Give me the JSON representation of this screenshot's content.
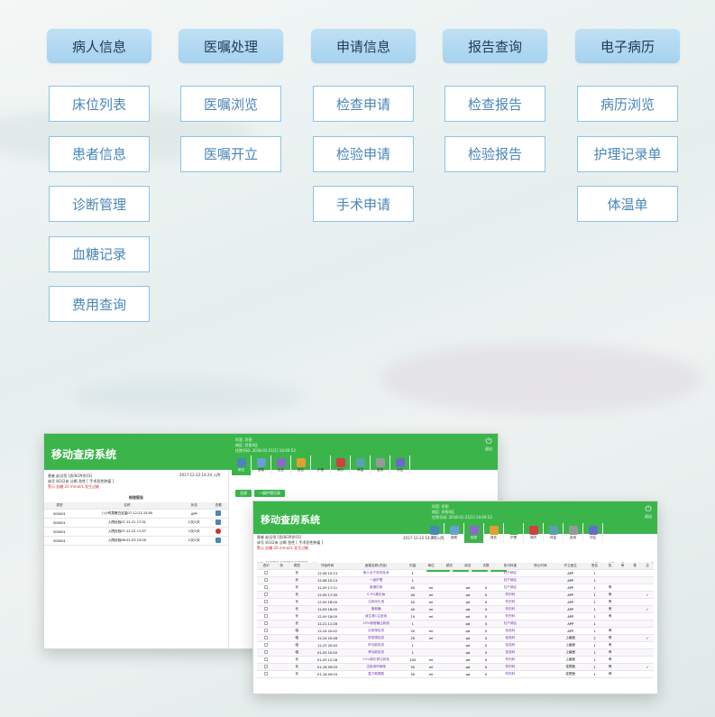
{
  "menu": {
    "columns": [
      {
        "header": "病人信息",
        "items": [
          "床位列表",
          "患者信息",
          "诊断管理",
          "血糖记录",
          "费用查询"
        ]
      },
      {
        "header": "医嘱处理",
        "items": [
          "医嘱浏览",
          "医嘱开立"
        ]
      },
      {
        "header": "申请信息",
        "items": [
          "检查申请",
          "检验申请",
          "手术申请"
        ]
      },
      {
        "header": "报告查询",
        "items": [
          "检查报告",
          "检验报告"
        ]
      },
      {
        "header": "电子病历",
        "items": [
          "病历浏览",
          "护理记录单",
          "体温单"
        ]
      }
    ]
  },
  "screen1": {
    "app_title": "移动查房系统",
    "exit_label": "退出",
    "patient_line1": "患者  赵远恒 [男/8/29岁03]",
    "patient_line2": "床号  8/3/2床     诊断  急性 [ 手术恶性肿瘤 ]",
    "patient_line3": "警示  血糖 20 mmol/L 发生过敏",
    "date_text": "2017-12-22 14:24 入院",
    "header_info": "科室: 肝胆\n病区: 肝胆4区\n住院号码: 2018-01-21[1] 14:00:53",
    "toolbar": [
      "床位",
      "医嘱",
      "检查",
      "报告",
      "护理",
      "病历",
      "体温",
      "费用",
      "评估"
    ],
    "sub_buttons": [
      "全部",
      "一级护理记录"
    ],
    "table_title": "检验报告",
    "columns": [
      "类型",
      "名称",
      "状态",
      "查看"
    ],
    "rows": [
      [
        "000001",
        "八小时尿蛋白定量07-12-22 15:00",
        "APP",
        ""
      ],
      [
        "000001",
        "入院化验07-12-21 17:31",
        "1次/1天",
        ""
      ],
      [
        "000001",
        "入院化验07-12-22 11:57",
        "1次/1天",
        ""
      ],
      [
        "000001",
        "入院化验08-01-03 15:00",
        "1次/1天",
        ""
      ]
    ]
  },
  "screen2": {
    "app_title": "移动查房系统",
    "exit_label": "退出",
    "patient_line1": "患者  赵远恒 [男/8/29岁03]",
    "patient_line2": "床号  8/3/2床     诊断  急性 [ 手术恶性肿瘤 ]",
    "patient_line3": "警示  血糖 20 mmol/L 发生过敏",
    "date_text": "2017-12-22 14:24 入院",
    "header_info": "科室: 肝胆\n病区: 肝胆4区\n住院号码: 2018-01-21[1] 14:00:53",
    "toolbar": [
      "床位",
      "医嘱",
      "检查",
      "报告",
      "护理",
      "病历",
      "体温",
      "费用",
      "评估"
    ],
    "filter_label": "类型",
    "filter_values": [
      "全部",
      "长期",
      "全部"
    ],
    "search_label": "查询",
    "action_buttons": [
      "新开医嘱",
      "停止",
      "作废",
      "打印"
    ],
    "legend": "■ 已过 ■ 新开 ■ 停止 ■ 作废 ■ 执行",
    "columns": [
      "选中",
      "状",
      "类型",
      "开始时间",
      "医嘱名称(内容)",
      "剂量",
      "单位",
      "频次",
      "用法",
      "天数",
      "执行科室",
      "停止时间",
      "开立医生",
      "签名",
      "执",
      "审",
      "核",
      "注"
    ],
    "rows": [
      [
        "",
        "",
        "长",
        "12-08 10:13",
        "病人全子宫切除术",
        "1",
        "",
        "",
        "",
        "",
        "妇产病区",
        "",
        "APP",
        "1",
        "",
        "",
        "",
        ""
      ],
      [
        "",
        "",
        "长",
        "12-08 10:13",
        "一级护理",
        "1",
        "",
        "",
        "",
        "",
        "妇产病区",
        "",
        "APP",
        "1",
        "",
        "",
        "",
        ""
      ],
      [
        "",
        "",
        "长",
        "12-09 17:11",
        "普通饮食",
        "40",
        "ml",
        "",
        "qd",
        "0",
        "妇产病区",
        "",
        "APP",
        "1",
        "有",
        "",
        "",
        ""
      ],
      [
        "",
        "",
        "长",
        "12-09 17:35",
        "0.9%氯化钠",
        "40",
        "ml",
        "",
        "qd",
        "0",
        "药剂科",
        "",
        "APP",
        "1",
        "有",
        "",
        "",
        "✓"
      ],
      [
        "",
        "",
        "长",
        "12-09 18:00",
        "注射用头孢",
        "40",
        "ml",
        "",
        "qd",
        "0",
        "药剂科",
        "",
        "APP",
        "1",
        "有",
        "",
        "",
        ""
      ],
      [
        "",
        "",
        "长",
        "12-09 18:05",
        "葡萄糖",
        "40",
        "ml",
        "",
        "qd",
        "0",
        "药剂科",
        "",
        "APP",
        "1",
        "有",
        "",
        "",
        "✓"
      ],
      [
        "",
        "",
        "长",
        "12-09 18:00",
        "维生素C注射液",
        "10",
        "ml",
        "",
        "qd",
        "0",
        "药剂科",
        "",
        "APP",
        "1",
        "有",
        "",
        "",
        ""
      ],
      [
        "",
        "",
        "长",
        "12-21 11:28",
        "10%葡萄糖注射液",
        "1",
        "",
        "",
        "qd",
        "0",
        "妇产病区",
        "",
        "APP",
        "1",
        "",
        "",
        "",
        ""
      ],
      [
        "",
        "",
        "临",
        "12-24 20:42",
        "血常规检查",
        "20",
        "ml",
        "",
        "qd",
        "0",
        "检验科",
        "",
        "APP",
        "1",
        "有",
        "",
        "",
        ""
      ],
      [
        "",
        "",
        "临",
        "12-24 20:48",
        "尿常规检查",
        "20",
        "ml",
        "",
        "qd",
        "0",
        "检验科",
        "",
        "上级医",
        "2",
        "有",
        "",
        "",
        "✓"
      ],
      [
        "",
        "",
        "临",
        "12-25 20:40",
        "肝功能检查",
        "1",
        "",
        "",
        "qd",
        "0",
        "检验科",
        "",
        "上级医",
        "1",
        "有",
        "",
        "",
        ""
      ],
      [
        "",
        "",
        "临",
        "01-05 10:50",
        "肾功能检查",
        "1",
        "",
        "",
        "qd",
        "0",
        "检验科",
        "",
        "上级医",
        "1",
        "有",
        "",
        "",
        ""
      ],
      [
        "",
        "",
        "长",
        "01-05 12:28",
        "10%氯化钾注射液",
        "100",
        "ml",
        "",
        "qd",
        "0",
        "药剂科",
        "",
        "上级医",
        "1",
        "有",
        "",
        "",
        ""
      ],
      [
        "",
        "",
        "长",
        "01-18 09:03",
        "注射用甲硝唑",
        "50",
        "ml",
        "",
        "qd",
        "0",
        "药剂科",
        "",
        "住院医",
        "1",
        "有",
        "",
        "",
        "✓"
      ],
      [
        "",
        "",
        "长",
        "01-18 09:03",
        "复方氨基酸",
        "50",
        "ml",
        "",
        "qd",
        "0",
        "药剂科",
        "",
        "住院医",
        "1",
        "有",
        "",
        "",
        ""
      ]
    ]
  }
}
